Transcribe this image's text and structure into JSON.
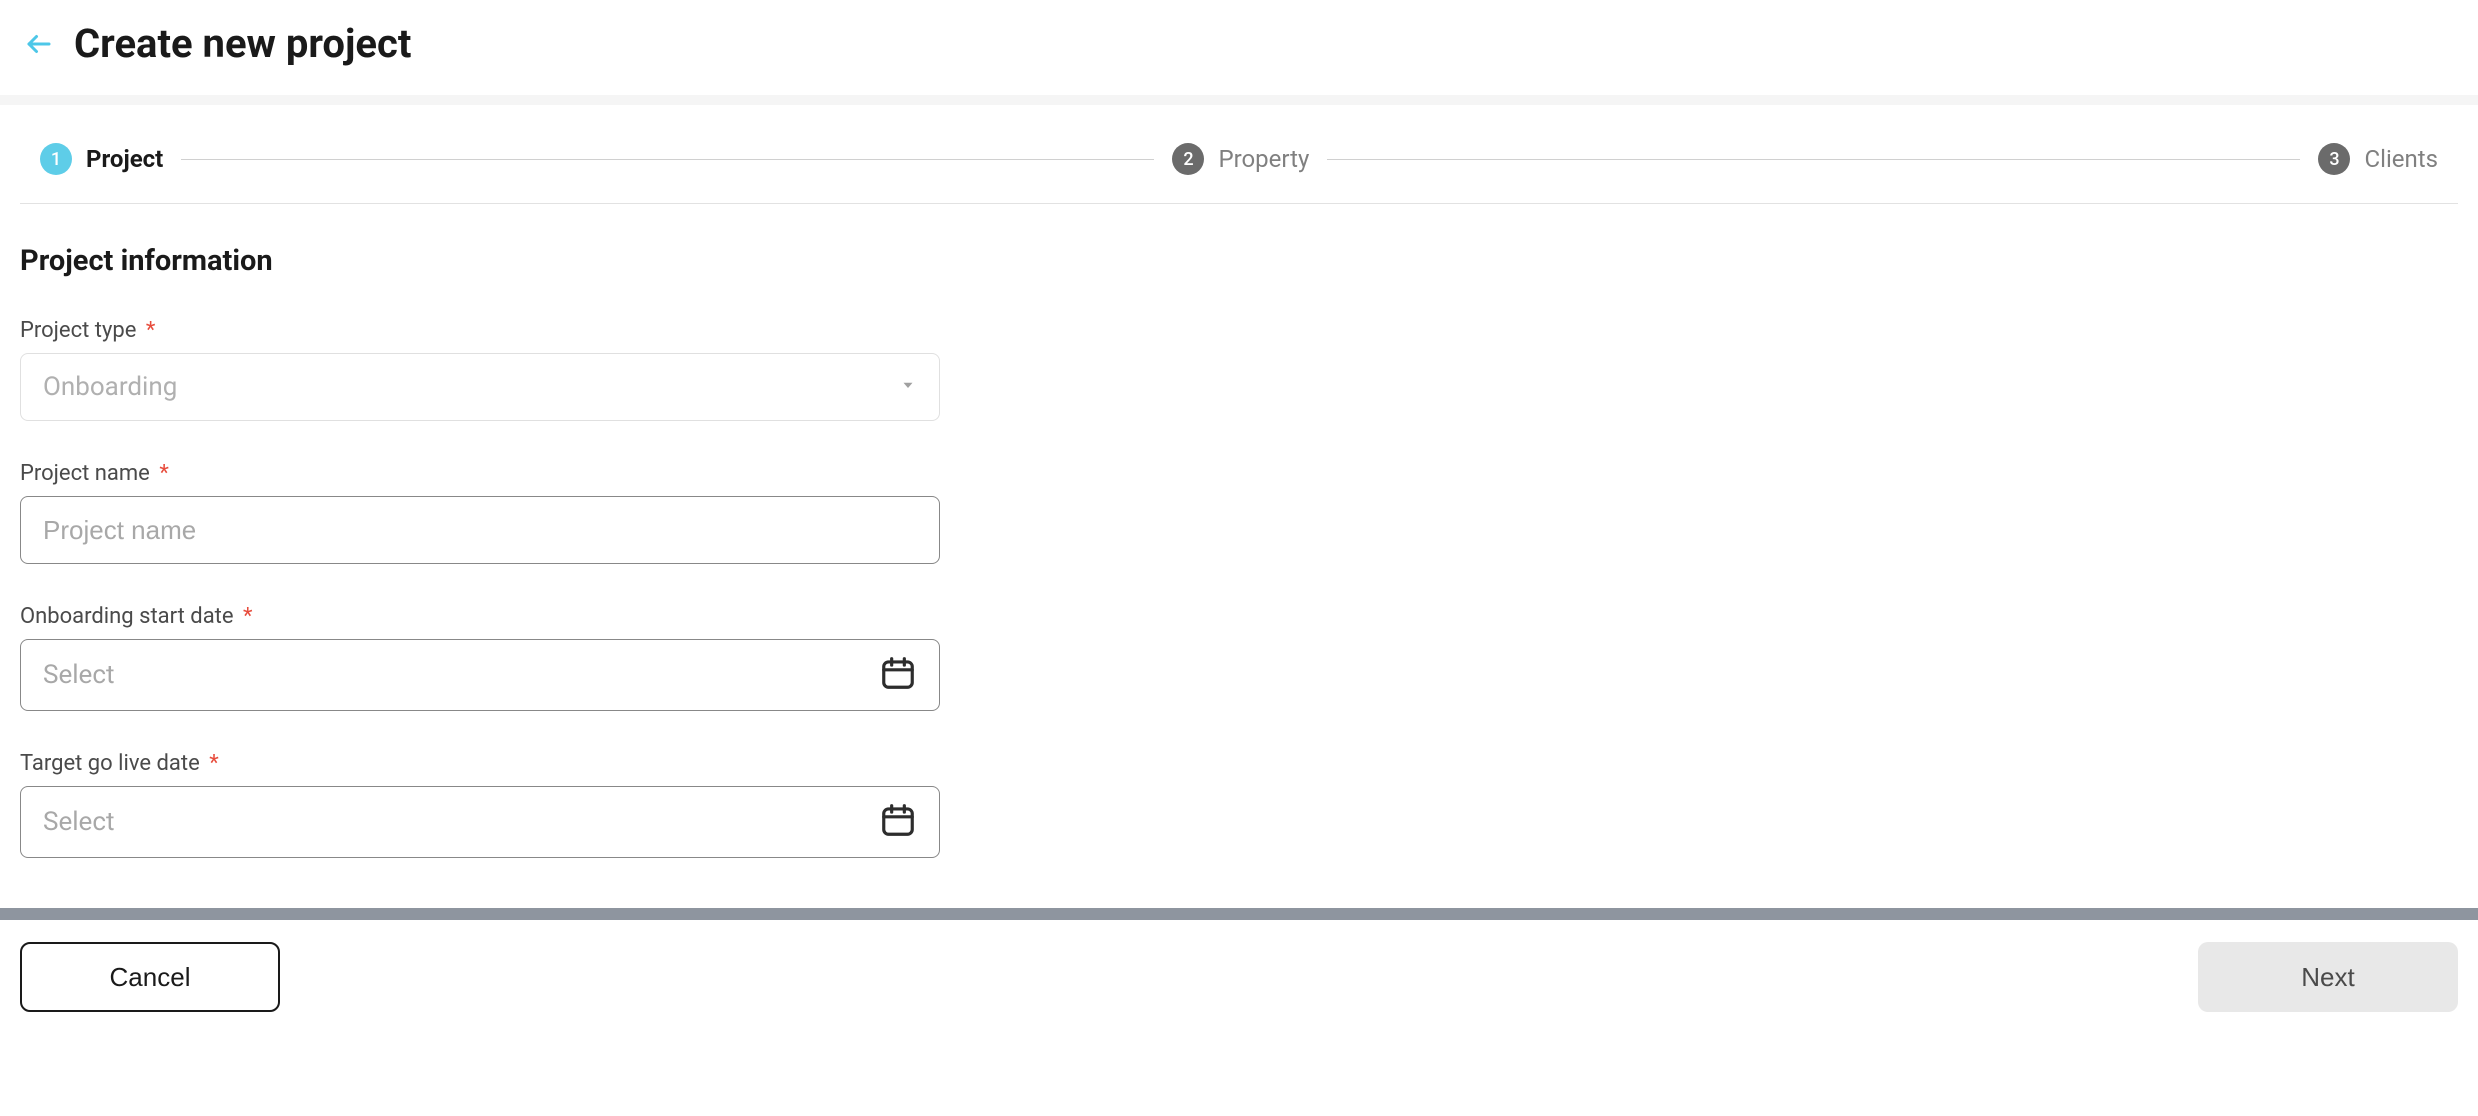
{
  "header": {
    "title": "Create new project"
  },
  "stepper": {
    "steps": [
      {
        "num": "1",
        "label": "Project",
        "active": true
      },
      {
        "num": "2",
        "label": "Property",
        "active": false
      },
      {
        "num": "3",
        "label": "Clients",
        "active": false
      }
    ]
  },
  "section": {
    "title": "Project information"
  },
  "fields": {
    "project_type": {
      "label": "Project type",
      "value": "Onboarding"
    },
    "project_name": {
      "label": "Project name",
      "placeholder": "Project name"
    },
    "onboarding_start": {
      "label": "Onboarding start date",
      "placeholder": "Select"
    },
    "target_go_live": {
      "label": "Target go live date",
      "placeholder": "Select"
    }
  },
  "actions": {
    "cancel": "Cancel",
    "next": "Next"
  },
  "required_marker": "*"
}
